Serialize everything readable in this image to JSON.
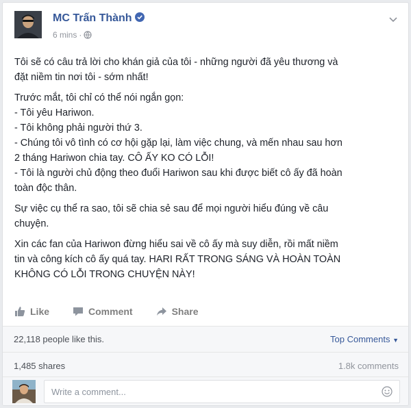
{
  "post": {
    "author": "MC Trấn Thành",
    "timestamp": "6 mins",
    "privacy_icon": "globe-icon",
    "verified_icon": "verified-badge-icon",
    "paragraphs": [
      [
        "Tôi sẽ có câu trả lời cho khán giả của tôi - những người đã yêu thương và",
        "đặt niềm tin nơi tôi - sớm nhất!"
      ],
      [
        "Trước mắt, tôi chỉ có thể nói ngắn gọn:",
        "- Tôi yêu Hariwon.",
        "- Tôi không phải người thứ 3.",
        "- Chúng tôi vô tình có cơ hội gặp lại, làm việc chung, và mến nhau sau hơn",
        "2 tháng Hariwon chia tay. CÔ ẤY KO CÓ LỖI!",
        "- Tôi là người chủ động theo đuổi Hariwon sau khi được biết cô ấy đã hoàn",
        "toàn độc thân."
      ],
      [
        "Sự việc cụ thể ra sao, tôi sẽ chia sẻ sau để mọi người hiểu đúng về câu",
        "chuyện."
      ],
      [
        "Xin các fan của Hariwon đừng hiểu sai về cô ấy mà suy diễn, rồi mất niềm",
        "tin và công kích cô ấy quá tay. HARI RẤT TRONG SÁNG VÀ HOÀN TOÀN",
        "KHÔNG CÓ LỖI TRONG CHUYỆN NÀY!"
      ]
    ]
  },
  "actions": {
    "like": "Like",
    "comment": "Comment",
    "share": "Share"
  },
  "stats": {
    "likes_text": "22,118 people like this.",
    "top_comments": "Top Comments",
    "shares": "1,485 shares",
    "comments": "1.8k comments"
  },
  "composer": {
    "placeholder": "Write a comment..."
  },
  "colors": {
    "link": "#365899",
    "muted": "#90949c",
    "verified": "#4267b2"
  }
}
